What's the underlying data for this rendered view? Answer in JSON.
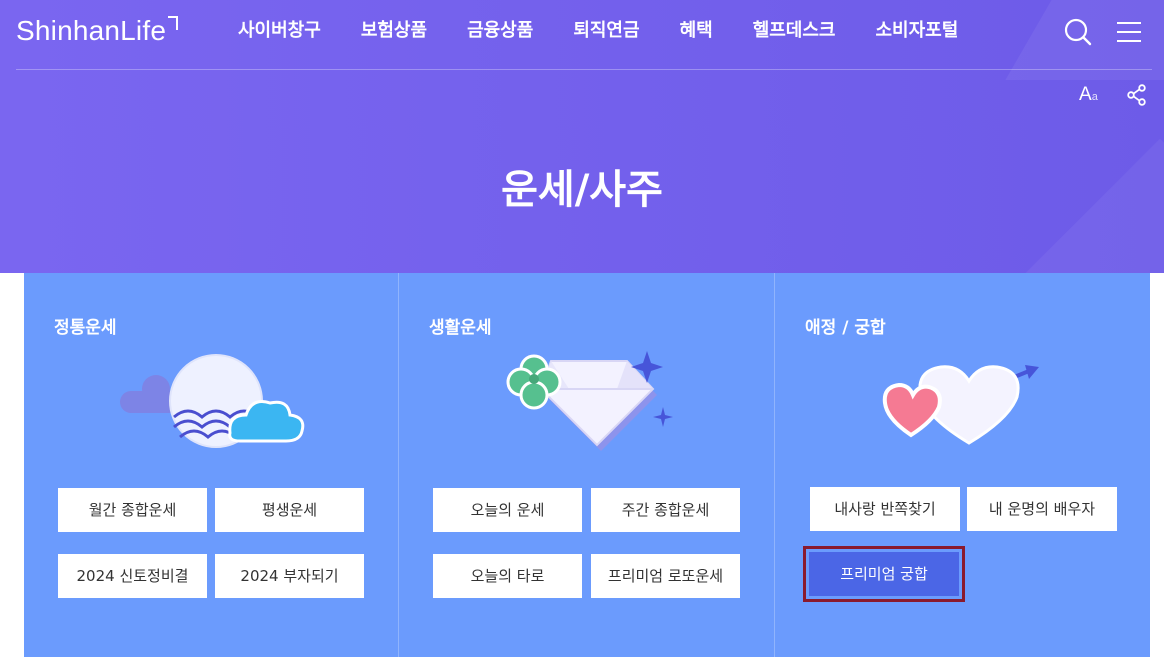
{
  "header": {
    "logo": "ShinhanLife",
    "nav": [
      "사이버창구",
      "보험상품",
      "금융상품",
      "퇴직연금",
      "혜택",
      "헬프데스크",
      "소비자포털"
    ],
    "font_size_label": "A",
    "font_size_sub": "a"
  },
  "page": {
    "title": "운세/사주"
  },
  "sections": [
    {
      "title": "정통운세",
      "buttons": [
        "월간 종합운세",
        "평생운세",
        "2024 신토정비결",
        "2024 부자되기"
      ]
    },
    {
      "title": "생활운세",
      "buttons": [
        "오늘의 운세",
        "주간 종합운세",
        "오늘의 타로",
        "프리미엄 로또운세"
      ]
    },
    {
      "title": "애정 / 궁합",
      "buttons": [
        "내사랑 반쪽찾기",
        "내 운명의 배우자",
        "프리미엄 궁합"
      ]
    }
  ],
  "colors": {
    "hero": "#7060ec",
    "content": "#6b9bfd",
    "active_button": "#4b66e6"
  }
}
